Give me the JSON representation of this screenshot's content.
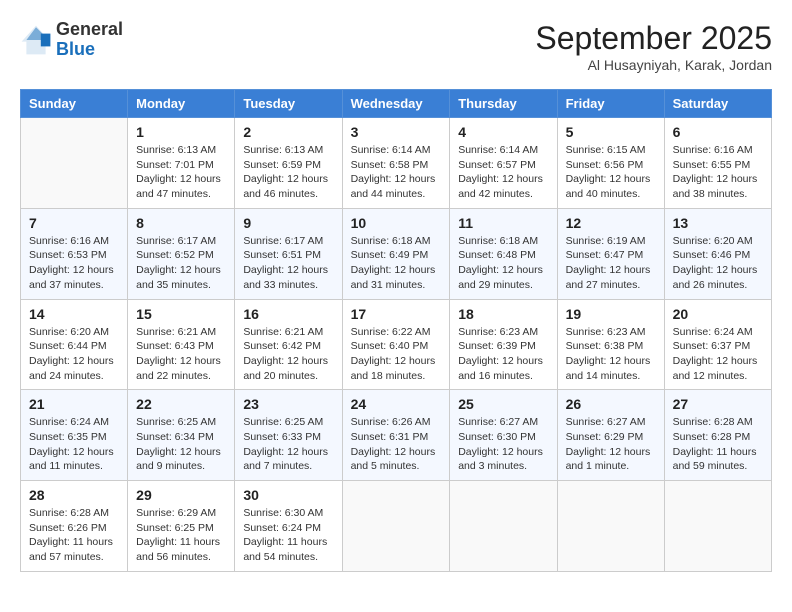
{
  "header": {
    "logo_general": "General",
    "logo_blue": "Blue",
    "month_title": "September 2025",
    "subtitle": "Al Husayniyah, Karak, Jordan"
  },
  "days_of_week": [
    "Sunday",
    "Monday",
    "Tuesday",
    "Wednesday",
    "Thursday",
    "Friday",
    "Saturday"
  ],
  "weeks": [
    [
      {
        "day": "",
        "info": ""
      },
      {
        "day": "1",
        "info": "Sunrise: 6:13 AM\nSunset: 7:01 PM\nDaylight: 12 hours\nand 47 minutes."
      },
      {
        "day": "2",
        "info": "Sunrise: 6:13 AM\nSunset: 6:59 PM\nDaylight: 12 hours\nand 46 minutes."
      },
      {
        "day": "3",
        "info": "Sunrise: 6:14 AM\nSunset: 6:58 PM\nDaylight: 12 hours\nand 44 minutes."
      },
      {
        "day": "4",
        "info": "Sunrise: 6:14 AM\nSunset: 6:57 PM\nDaylight: 12 hours\nand 42 minutes."
      },
      {
        "day": "5",
        "info": "Sunrise: 6:15 AM\nSunset: 6:56 PM\nDaylight: 12 hours\nand 40 minutes."
      },
      {
        "day": "6",
        "info": "Sunrise: 6:16 AM\nSunset: 6:55 PM\nDaylight: 12 hours\nand 38 minutes."
      }
    ],
    [
      {
        "day": "7",
        "info": "Sunrise: 6:16 AM\nSunset: 6:53 PM\nDaylight: 12 hours\nand 37 minutes."
      },
      {
        "day": "8",
        "info": "Sunrise: 6:17 AM\nSunset: 6:52 PM\nDaylight: 12 hours\nand 35 minutes."
      },
      {
        "day": "9",
        "info": "Sunrise: 6:17 AM\nSunset: 6:51 PM\nDaylight: 12 hours\nand 33 minutes."
      },
      {
        "day": "10",
        "info": "Sunrise: 6:18 AM\nSunset: 6:49 PM\nDaylight: 12 hours\nand 31 minutes."
      },
      {
        "day": "11",
        "info": "Sunrise: 6:18 AM\nSunset: 6:48 PM\nDaylight: 12 hours\nand 29 minutes."
      },
      {
        "day": "12",
        "info": "Sunrise: 6:19 AM\nSunset: 6:47 PM\nDaylight: 12 hours\nand 27 minutes."
      },
      {
        "day": "13",
        "info": "Sunrise: 6:20 AM\nSunset: 6:46 PM\nDaylight: 12 hours\nand 26 minutes."
      }
    ],
    [
      {
        "day": "14",
        "info": "Sunrise: 6:20 AM\nSunset: 6:44 PM\nDaylight: 12 hours\nand 24 minutes."
      },
      {
        "day": "15",
        "info": "Sunrise: 6:21 AM\nSunset: 6:43 PM\nDaylight: 12 hours\nand 22 minutes."
      },
      {
        "day": "16",
        "info": "Sunrise: 6:21 AM\nSunset: 6:42 PM\nDaylight: 12 hours\nand 20 minutes."
      },
      {
        "day": "17",
        "info": "Sunrise: 6:22 AM\nSunset: 6:40 PM\nDaylight: 12 hours\nand 18 minutes."
      },
      {
        "day": "18",
        "info": "Sunrise: 6:23 AM\nSunset: 6:39 PM\nDaylight: 12 hours\nand 16 minutes."
      },
      {
        "day": "19",
        "info": "Sunrise: 6:23 AM\nSunset: 6:38 PM\nDaylight: 12 hours\nand 14 minutes."
      },
      {
        "day": "20",
        "info": "Sunrise: 6:24 AM\nSunset: 6:37 PM\nDaylight: 12 hours\nand 12 minutes."
      }
    ],
    [
      {
        "day": "21",
        "info": "Sunrise: 6:24 AM\nSunset: 6:35 PM\nDaylight: 12 hours\nand 11 minutes."
      },
      {
        "day": "22",
        "info": "Sunrise: 6:25 AM\nSunset: 6:34 PM\nDaylight: 12 hours\nand 9 minutes."
      },
      {
        "day": "23",
        "info": "Sunrise: 6:25 AM\nSunset: 6:33 PM\nDaylight: 12 hours\nand 7 minutes."
      },
      {
        "day": "24",
        "info": "Sunrise: 6:26 AM\nSunset: 6:31 PM\nDaylight: 12 hours\nand 5 minutes."
      },
      {
        "day": "25",
        "info": "Sunrise: 6:27 AM\nSunset: 6:30 PM\nDaylight: 12 hours\nand 3 minutes."
      },
      {
        "day": "26",
        "info": "Sunrise: 6:27 AM\nSunset: 6:29 PM\nDaylight: 12 hours\nand 1 minute."
      },
      {
        "day": "27",
        "info": "Sunrise: 6:28 AM\nSunset: 6:28 PM\nDaylight: 11 hours\nand 59 minutes."
      }
    ],
    [
      {
        "day": "28",
        "info": "Sunrise: 6:28 AM\nSunset: 6:26 PM\nDaylight: 11 hours\nand 57 minutes."
      },
      {
        "day": "29",
        "info": "Sunrise: 6:29 AM\nSunset: 6:25 PM\nDaylight: 11 hours\nand 56 minutes."
      },
      {
        "day": "30",
        "info": "Sunrise: 6:30 AM\nSunset: 6:24 PM\nDaylight: 11 hours\nand 54 minutes."
      },
      {
        "day": "",
        "info": ""
      },
      {
        "day": "",
        "info": ""
      },
      {
        "day": "",
        "info": ""
      },
      {
        "day": "",
        "info": ""
      }
    ]
  ]
}
